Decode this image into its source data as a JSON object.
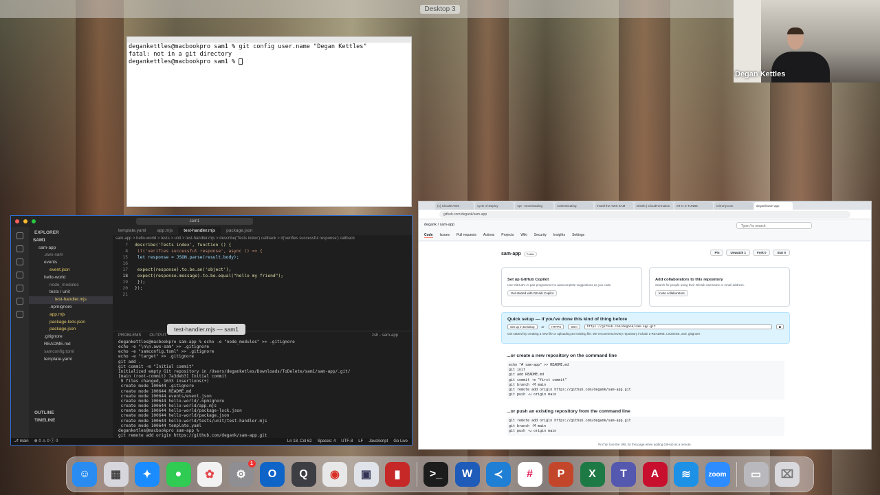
{
  "desktop_label": "Desktop 3",
  "terminal": {
    "lines": [
      "degankettles@macbookpro sam1 % git config user.name \"Degan Kettles\"",
      "fatal: not in a git directory",
      "degankettles@macbookpro sam1 % "
    ]
  },
  "webcam": {
    "name": "Degan Kettles"
  },
  "vscode": {
    "search": "sam1",
    "sidebar": {
      "header": "EXPLORER",
      "items": [
        "SAM1",
        "sam-app",
        ".aws-sam",
        "events",
        "event.json",
        "hello-world",
        "node_modules",
        "tests / unit",
        "test-handler.mjs",
        ".npmignore",
        "app.mjs",
        "package-lock.json",
        "package.json",
        ".gitignore",
        "README.md",
        "samconfig.toml",
        "template.yaml"
      ],
      "outline": "OUTLINE",
      "timeline": "TIMELINE"
    },
    "tabs": [
      "template.yaml",
      "app.mjs",
      "test-handler.mjs",
      "package.json"
    ],
    "breadcrumb": "sam-app > hello-world > tests > unit > test-handler.mjs > describe('Tests index') callback > it('verifies successful response') callback",
    "code_lines": [
      {
        "n": "7",
        "t": "describe('Tests index', function () {"
      },
      {
        "n": "8",
        "t": "    it('verifies successful response', async () => {"
      },
      {
        "n": "15",
        "t": "        let response = JSON.parse(result.body);"
      },
      {
        "n": "16",
        "t": ""
      },
      {
        "n": "17",
        "t": "        expect(response).to.be.an('object');"
      },
      {
        "n": "18",
        "t": "        expect(response.message).to.be.equal(\"hello my friend\");"
      },
      {
        "n": "19",
        "t": "    });"
      },
      {
        "n": "20",
        "t": "});"
      },
      {
        "n": "21",
        "t": ""
      }
    ],
    "panel_tabs": [
      "PROBLEMS",
      "OUTPUT"
    ],
    "terminal_tab": "zsh - sam-app",
    "tooltip": "test-handler.mjs — sam1",
    "terminal_lines": [
      "degankettles@macbookpro sam-app % echo -e \"node_modules\" >> .gitignore",
      "echo -e \"\\n\\n.aws-sam\" >> .gitignore",
      "echo -e \"samconfig.toml\" >> .gitignore",
      "echo -e \"target\" >> .gitignore",
      "git add .",
      "git commit -m \"Initial commit\"",
      "Initialized empty Git repository in /Users/deganketles/Downloads/ToDelete/sam1/sam-app/.git/",
      "[main (root-commit) 7a3deb3] Initial commit",
      " 9 files changed, 1633 insertions(+)",
      " create mode 100644 .gitignore",
      " create mode 100644 README.md",
      " create mode 100644 events/event.json",
      " create mode 100644 hello-world/.npmignore",
      " create mode 100644 hello-world/app.mjs",
      " create mode 100644 hello-world/package-lock.json",
      " create mode 100644 hello-world/package.json",
      " create mode 100644 hello-world/tests/unit/test-handler.mjs",
      " create mode 100644 template.yaml",
      "deganketles@macbookpro sam-app %",
      "git remote add origin https://github.com/degank/sam-app.git",
      "deganketles@macbookpro sam-app % "
    ],
    "status": {
      "branch": "main",
      "errors": "0",
      "warnings": "0",
      "info": "0",
      "position": "Ln 18, Col 62",
      "spaces": "Spaces: 4",
      "encoding": "UTF-8",
      "eol": "LF",
      "lang": "JavaScript",
      "golive": "Go Live"
    }
  },
  "browser": {
    "tabs": [
      "(1) Cloud9 AWS",
      "cycle of Deploy",
      "Apr - Downloading",
      "Authenticating",
      "Install the AWS SAM",
      "Distrib | CloudFormation",
      "ST C-S TUNBE",
      "mirrorly.com",
      "degank/sam-app"
    ],
    "url": "github.com/degank/sam-app",
    "crumb": "degank / sam-app",
    "search_placeholder": "Type / to search",
    "nav": [
      "Code",
      "Issues",
      "Pull requests",
      "Actions",
      "Projects",
      "Wiki",
      "Security",
      "Insights",
      "Settings"
    ],
    "repo_name": "sam-app",
    "visibility": "Public",
    "repo_actions": [
      "Pin",
      "Unwatch 1",
      "Fork 0",
      "Star 0"
    ],
    "card1": {
      "title": "Set up GitHub Copilot",
      "desc": "Use GitHub's AI pair programmer to autocomplete suggestions as you code.",
      "btn": "Get started with GitHub Copilot"
    },
    "card2": {
      "title": "Add collaborators to this repository",
      "desc": "Search for people using their GitHub username or email address.",
      "btn": "Invite collaborators"
    },
    "quick_setup": {
      "title": "Quick setup — if you've done this kind of thing before",
      "desktop": "Set up in Desktop",
      "or": "or",
      "https": "HTTPS",
      "ssh": "SSH",
      "url": "https://github.com/degank/sam-app.git",
      "note": "Get started by creating a new file or uploading an existing file. We recommend every repository include a README, LICENSE, and .gitignore."
    },
    "section1": "...or create a new repository on the command line",
    "cmd1": "echo \"# sam-app\" >> README.md\ngit init\ngit add README.md\ngit commit -m \"first commit\"\ngit branch -M main\ngit remote add origin https://github.com/degank/sam-app.git\ngit push -u origin main",
    "section2": "...or push an existing repository from the command line",
    "cmd2": "git remote add origin https://github.com/degank/sam-app.git\ngit branch -M main\ngit push -u origin main",
    "protip": "ProTip! Use the URL for this page when adding GitHub as a remote."
  },
  "dock": {
    "apps": [
      "finder-icon",
      "launchpad-icon",
      "safari-icon",
      "messages-icon",
      "photos-icon",
      "system-settings-icon",
      "outlook-icon",
      "quicktime-icon",
      "chrome-icon",
      "preview-icon",
      "notes-icon",
      "terminal-icon",
      "word-icon",
      "vscode-icon",
      "slack-icon",
      "powerpoint-icon",
      "excel-icon",
      "teams-icon",
      "acrobat-icon",
      "docker-icon",
      "zoom-icon",
      "downloads-icon",
      "trash-icon"
    ],
    "settings_badge": "1",
    "colors": {
      "finder": "#2a8cf0",
      "vscode": "#1f7fd4",
      "chrome": "#e8e8e8",
      "slack": "#ffffff",
      "zoom": "#2d8cff"
    }
  }
}
